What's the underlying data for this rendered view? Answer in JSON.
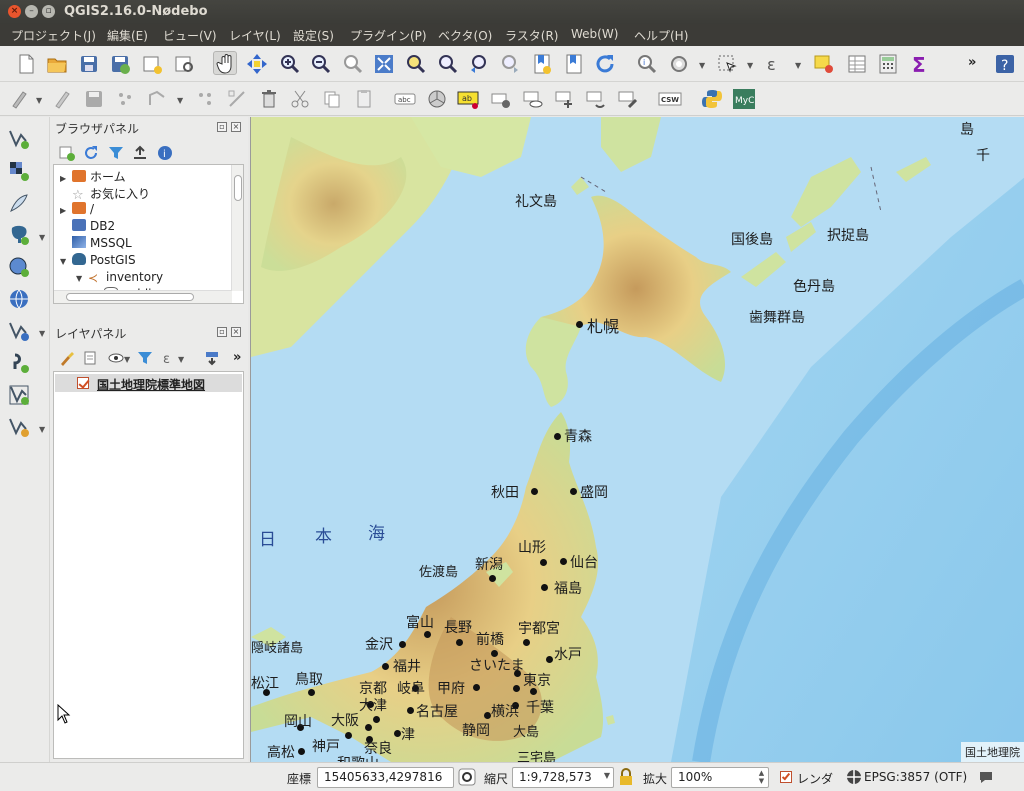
{
  "window": {
    "title": "QGIS2.16.0-Nødebo"
  },
  "menu": {
    "items": [
      "プロジェクト(J)",
      "編集(E)",
      "ビュー(V)",
      "レイヤ(L)",
      "設定(S)",
      "プラグイン(P)",
      "ベクタ(O)",
      "ラスタ(R)",
      "Web(W)",
      "ヘルプ(H)"
    ]
  },
  "toolbar": {
    "overflow": "»",
    "label_icons": {
      "abc": "abc",
      "csw": "CSW",
      "myc": "MyC",
      "sigma": "Σ",
      "ab_edit": "ab"
    }
  },
  "browser_panel": {
    "title": "ブラウザパネル",
    "items": [
      {
        "label": "ホーム",
        "icon": "folder-icon",
        "arrow": "▶"
      },
      {
        "label": "お気に入り",
        "icon": "star-icon",
        "arrow": ""
      },
      {
        "label": "/",
        "icon": "folder-icon",
        "arrow": "▶"
      },
      {
        "label": "DB2",
        "icon": "db2-icon",
        "arrow": ""
      },
      {
        "label": "MSSQL",
        "icon": "mssql-icon",
        "arrow": ""
      },
      {
        "label": "PostGIS",
        "icon": "postgis-elephant-icon",
        "arrow": "▼"
      },
      {
        "label": "inventory",
        "icon": "connection-icon",
        "arrow": "▼"
      },
      {
        "label": "public",
        "icon": "schema-icon",
        "arrow": "▼"
      }
    ]
  },
  "layer_panel": {
    "title": "レイヤパネル",
    "overflow": "»",
    "layers": [
      {
        "name": "国土地理院標準地図",
        "visible": true
      }
    ]
  },
  "map": {
    "attribution": "国土地理院",
    "sea_labels": [
      "日",
      "本",
      "海"
    ],
    "island_labels": [
      "礼文島",
      "国後島",
      "択捉島",
      "色丹島",
      "歯舞群島",
      "佐渡島",
      "隠岐諸島",
      "大島",
      "三宅島"
    ],
    "cities": [
      "札幌",
      "青森",
      "秋田",
      "盛岡",
      "山形",
      "仙台",
      "新潟",
      "福島",
      "富山",
      "長野",
      "金沢",
      "前橋",
      "宇都宮",
      "福井",
      "さいたま",
      "水戸",
      "岐阜",
      "甲府",
      "東京",
      "千葉",
      "名古屋",
      "横浜",
      "静岡",
      "京都",
      "大津",
      "大阪",
      "奈良",
      "津",
      "神戸",
      "鳥取",
      "松江",
      "岡山",
      "高松",
      "和歌山"
    ],
    "edge_labels": [
      "千",
      "島"
    ],
    "colors": {
      "sea_shallow": "#b4dcf3",
      "sea_deep": "#7cc3ec",
      "land_low": "#c8dc96",
      "land_mid": "#e8cf86",
      "land_high": "#c59a5c"
    }
  },
  "statusbar": {
    "coord_label": "座標",
    "coord_value": "15405633,4297816",
    "scale_label": "縮尺",
    "scale_value": "1:9,728,573",
    "zoom_label": "拡大",
    "zoom_value": "100%",
    "render_label": "レンダ",
    "render_checked": true,
    "crs": "EPSG:3857 (OTF)"
  }
}
